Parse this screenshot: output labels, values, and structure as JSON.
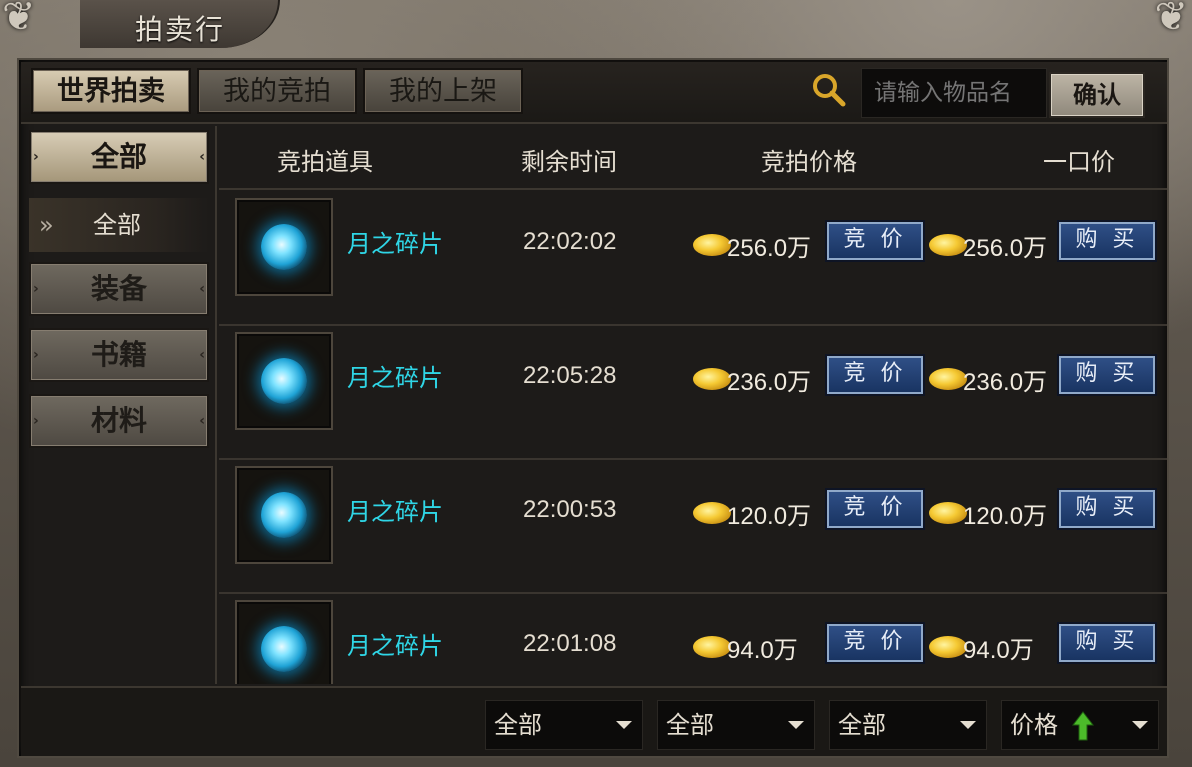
{
  "window": {
    "title": "拍卖行"
  },
  "tabs": [
    {
      "label": "世界拍卖",
      "active": true
    },
    {
      "label": "我的竞拍",
      "active": false
    },
    {
      "label": "我的上架",
      "active": false
    }
  ],
  "search": {
    "placeholder": "请输入物品名",
    "confirm_label": "确认"
  },
  "sidebar": {
    "categories": [
      {
        "label": "全部",
        "active": true
      },
      {
        "label": "装备",
        "active": false
      },
      {
        "label": "书籍",
        "active": false
      },
      {
        "label": "材料",
        "active": false
      }
    ],
    "sub_item": {
      "chevron": "»",
      "label": "全部"
    }
  },
  "table": {
    "headers": [
      "竞拍道具",
      "剩余时间",
      "竞拍价格",
      "一口价"
    ],
    "bid_label": "竞 价",
    "buy_label": "购 买",
    "rows": [
      {
        "item": "月之碎片",
        "time": "22:02:02",
        "bid_price": "256.0万",
        "buyout_price": "256.0万"
      },
      {
        "item": "月之碎片",
        "time": "22:05:28",
        "bid_price": "236.0万",
        "buyout_price": "236.0万"
      },
      {
        "item": "月之碎片",
        "time": "22:00:53",
        "bid_price": "120.0万",
        "buyout_price": "120.0万"
      },
      {
        "item": "月之碎片",
        "time": "22:01:08",
        "bid_price": "94.0万",
        "buyout_price": "94.0万"
      }
    ]
  },
  "filters": [
    {
      "value": "全部"
    },
    {
      "value": "全部"
    },
    {
      "value": "全部"
    },
    {
      "value": "价格",
      "sort_icon": "green-up-arrow-icon"
    }
  ],
  "colors": {
    "item_name": "#2fd6e6",
    "action_button": "#2f4f86",
    "active_tab": "#d8ccb3",
    "sort_arrow": "#4cbb2a"
  }
}
